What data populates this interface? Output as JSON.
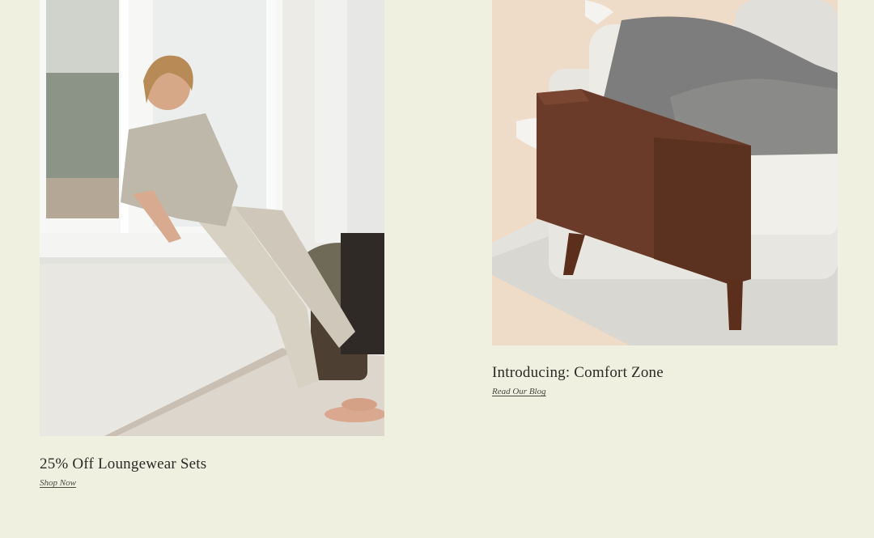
{
  "cards": [
    {
      "title": "25% Off Loungewear Sets",
      "link": "Shop Now",
      "image": "woman-in-loungewear-by-window"
    },
    {
      "title": "Introducing: Comfort Zone",
      "link": "Read Our Blog",
      "image": "person-lounging-on-wooden-armchair"
    }
  ],
  "colors": {
    "background": "#eff0e0",
    "text": "#2b2a26"
  }
}
